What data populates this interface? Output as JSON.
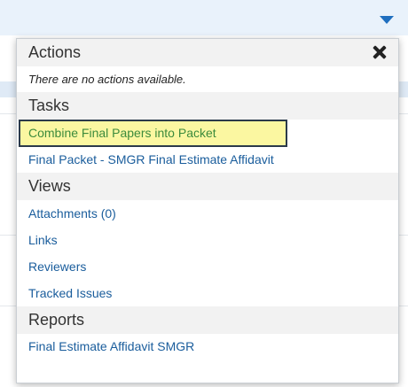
{
  "colors": {
    "link": "#1a5d9c",
    "highlight_bg": "#fbf7a1",
    "highlight_text": "#3c8b3c",
    "header_bg": "#f2f2f2"
  },
  "popup": {
    "actions": {
      "title": "Actions",
      "empty_message": "There are no actions available.",
      "close_icon": "close-icon"
    },
    "tasks": {
      "title": "Tasks",
      "items": [
        "Combine Final Papers into Packet",
        "Final Packet - SMGR Final Estimate Affidavit"
      ]
    },
    "views": {
      "title": "Views",
      "items": [
        "Attachments (0)",
        "Links",
        "Reviewers",
        "Tracked Issues"
      ]
    },
    "reports": {
      "title": "Reports",
      "items": [
        "Final Estimate Affidavit SMGR"
      ]
    }
  }
}
